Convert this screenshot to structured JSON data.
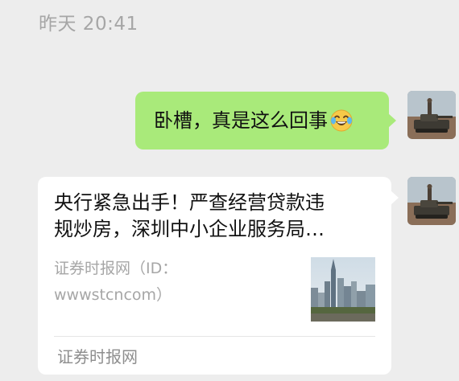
{
  "chat": {
    "timestamp": "昨天 20:41",
    "messages": [
      {
        "type": "text",
        "sender": "self",
        "text": "卧槽，真是这么回事",
        "emoji": "face-with-tears-of-joy"
      },
      {
        "type": "link-card",
        "sender": "self",
        "title": "央行紧急出手！严查经营贷款违\n规炒房，深圳中小企业服务局…",
        "description": "证券时报网（ID：\nwwwstcncom）",
        "source": "证券时报网",
        "thumbnail_icon": "city-skyline-thumbnail"
      }
    ]
  },
  "colors": {
    "background": "#ededed",
    "outgoing_bubble": "#a9ea7a",
    "card_bubble": "#ffffff",
    "timestamp_text": "#a6a6a6"
  }
}
